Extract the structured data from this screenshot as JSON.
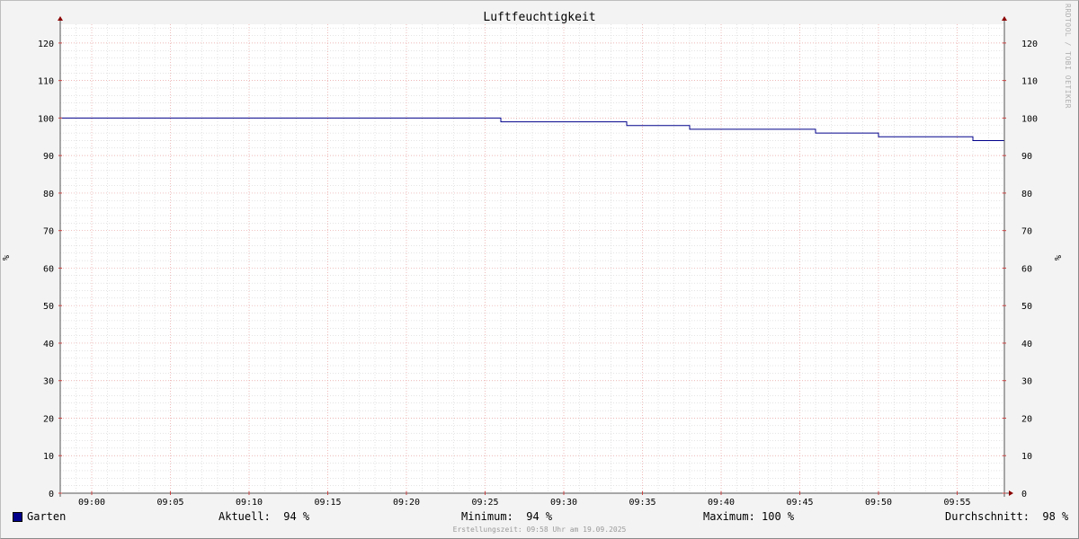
{
  "window": {
    "watermark": "RRDTOOL / TOBI OETIKER"
  },
  "chart_data": {
    "type": "line",
    "title": "Luftfeuchtigkeit",
    "ylabel": "%",
    "ylabel_right": "%",
    "ylim": [
      0,
      125
    ],
    "yticks": [
      0,
      10,
      20,
      30,
      40,
      50,
      60,
      70,
      80,
      90,
      100,
      110,
      120
    ],
    "xrange_minutes": [
      -2,
      58
    ],
    "xticks": [
      {
        "label": "09:00",
        "minute": 0
      },
      {
        "label": "09:05",
        "minute": 5
      },
      {
        "label": "09:10",
        "minute": 10
      },
      {
        "label": "09:15",
        "minute": 15
      },
      {
        "label": "09:20",
        "minute": 20
      },
      {
        "label": "09:25",
        "minute": 25
      },
      {
        "label": "09:30",
        "minute": 30
      },
      {
        "label": "09:35",
        "minute": 35
      },
      {
        "label": "09:40",
        "minute": 40
      },
      {
        "label": "09:45",
        "minute": 45
      },
      {
        "label": "09:50",
        "minute": 50
      },
      {
        "label": "09:55",
        "minute": 55
      }
    ],
    "grid": true,
    "colors": {
      "line": "#00008b",
      "major_grid": "#e8a0a0",
      "minor_grid": "#c8c8c8",
      "background": "#ffffff",
      "axis": "#555555",
      "arrow": "#8b0000"
    },
    "series": [
      {
        "name": "Garten",
        "step": true,
        "points": [
          {
            "time": "08:58",
            "value": 100
          },
          {
            "time": "09:26",
            "value": 99
          },
          {
            "time": "09:34",
            "value": 98
          },
          {
            "time": "09:36",
            "value": 98
          },
          {
            "time": "09:38",
            "value": 97
          },
          {
            "time": "09:46",
            "value": 96
          },
          {
            "time": "09:50",
            "value": 95
          },
          {
            "time": "09:56",
            "value": 94
          },
          {
            "time": "09:58",
            "value": 94
          }
        ]
      }
    ]
  },
  "legend": {
    "series_name": "Garten",
    "aktuell": "Aktuell:  94 %",
    "minimum": "Minimum:  94 %",
    "maximum": "Maximum: 100 %",
    "durchschnitt": "Durchschnitt:  98 %"
  },
  "footer": "Erstellungszeit: 09:58 Uhr am 19.09.2025"
}
